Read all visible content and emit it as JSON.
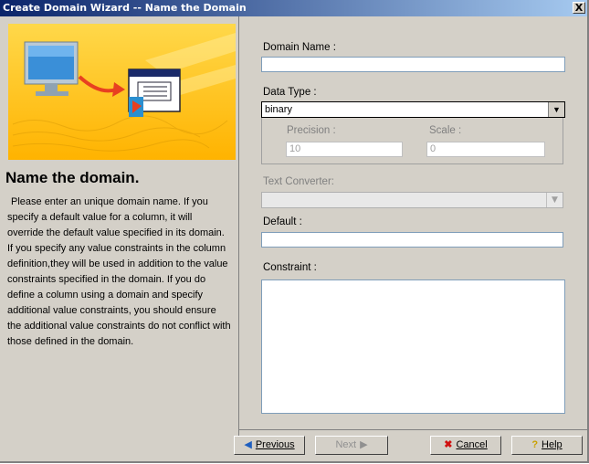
{
  "window": {
    "title": "Create Domain Wizard -- Name the Domain",
    "close_label": "X"
  },
  "left": {
    "heading": "Name the domain.",
    "description": "Please enter an unique domain name. If you specify a default value for a column, it will override the default value specified in its domain. If you specify any value constraints in the column definition,they will be used in addition to the value constraints specified in the domain. If you do define a column using a domain and specify additional value constraints, you should ensure the additional value constraints do not conflict with those defined in the domain."
  },
  "form": {
    "domain_name_label": "Domain Name :",
    "domain_name_value": "",
    "data_type_label": "Data Type :",
    "data_type_value": "binary",
    "precision_label": "Precision :",
    "precision_value": "10",
    "scale_label": "Scale :",
    "scale_value": "0",
    "text_converter_label": "Text Converter:",
    "default_label": "Default :",
    "default_value": "",
    "constraint_label": "Constraint :"
  },
  "buttons": {
    "previous": "Previous",
    "next": "Next",
    "cancel": "Cancel",
    "help": "Help"
  },
  "icons": {
    "previous": "arrow-left-icon",
    "next": "arrow-right-icon",
    "cancel": "red-x-icon",
    "help": "question-mark-icon",
    "dropdown": "chevron-down-icon"
  }
}
